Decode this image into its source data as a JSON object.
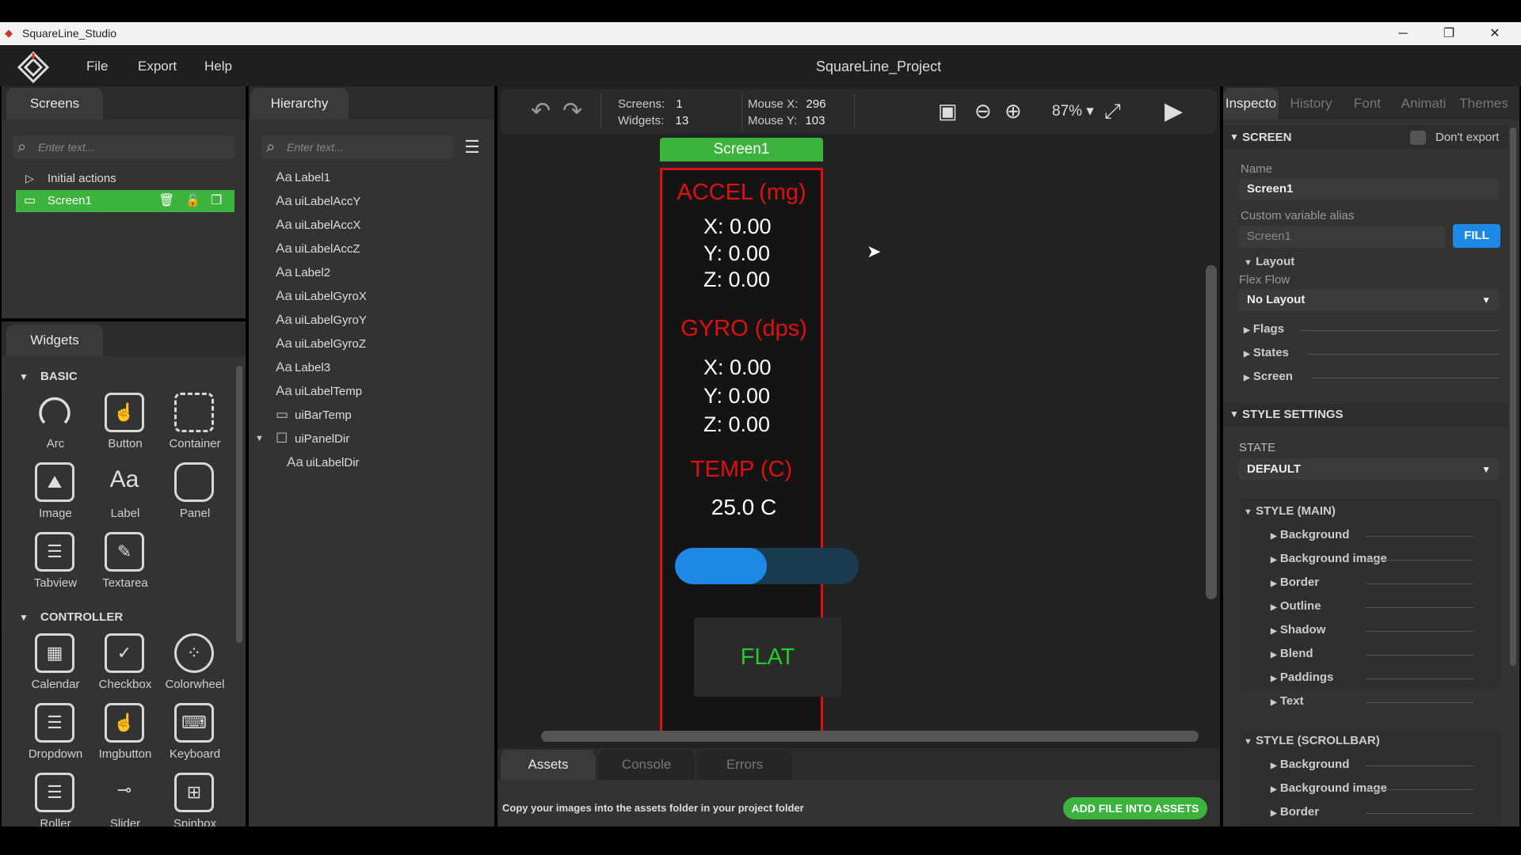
{
  "window": {
    "title": "SquareLine_Studio",
    "min": "─",
    "restore": "❐",
    "close": "✕"
  },
  "menu": {
    "file": "File",
    "export": "Export",
    "help": "Help",
    "project_title": "SquareLine_Project"
  },
  "screens_panel": {
    "tab": "Screens",
    "search_placeholder": "Enter text...",
    "items": [
      {
        "label": "Initial actions"
      },
      {
        "label": "Screen1"
      }
    ]
  },
  "widgets_panel": {
    "tab": "Widgets",
    "basic_header": "BASIC",
    "controller_header": "CONTROLLER",
    "basic": [
      "Arc",
      "Button",
      "Container",
      "Image",
      "Label",
      "Panel",
      "Tabview",
      "Textarea"
    ],
    "controller": [
      "Calendar",
      "Checkbox",
      "Colorwheel",
      "Dropdown",
      "Imgbutton",
      "Keyboard",
      "Roller",
      "Slider",
      "Spinbox"
    ]
  },
  "hierarchy": {
    "tab": "Hierarchy",
    "search_placeholder": "Enter text...",
    "aa": "Aa",
    "items": [
      "Label1",
      "uiLabelAccY",
      "uiLabelAccX",
      "uiLabelAccZ",
      "Label2",
      "uiLabelGyroX",
      "uiLabelGyroY",
      "uiLabelGyroZ",
      "Label3",
      "uiLabelTemp",
      "uiBarTemp",
      "uiPanelDir",
      "uiLabelDir"
    ]
  },
  "toolbar": {
    "screens_label": "Screens:",
    "screens_val": "1",
    "widgets_label": "Widgets:",
    "widgets_val": "13",
    "mousex_label": "Mouse X:",
    "mousex_val": "296",
    "mousey_label": "Mouse Y:",
    "mousey_val": "103",
    "zoom": "87%"
  },
  "canvas": {
    "screen_tab": "Screen1",
    "accel_title": "ACCEL (mg)",
    "ax": "X: 0.00",
    "ay": "Y: 0.00",
    "az": "Z: 0.00",
    "gyro_title": "GYRO (dps)",
    "gx": "X: 0.00",
    "gy": "Y: 0.00",
    "gz": "Z: 0.00",
    "temp_title": "TEMP (C)",
    "temp_val": "25.0 C",
    "bar_fraction": 0.5,
    "dir_label": "FLAT"
  },
  "bottom": {
    "tabs": [
      "Assets",
      "Console",
      "Errors"
    ],
    "hint": "Copy your images into the assets folder in your project folder",
    "add_btn": "ADD FILE INTO ASSETS"
  },
  "inspector": {
    "tabs": [
      "Inspecto",
      "History",
      "Font",
      "Animati",
      "Themes"
    ],
    "screen_header": "SCREEN",
    "dont_export": "Don't export",
    "name_label": "Name",
    "name_val": "Screen1",
    "alias_label": "Custom variable alias",
    "alias_val": "Screen1",
    "fill_btn": "FILL",
    "layout": "Layout",
    "flexflow_label": "Flex Flow",
    "flexflow_val": "No Layout",
    "collapsibles": [
      "Flags",
      "States",
      "Screen"
    ],
    "style_settings": "STYLE SETTINGS",
    "state_label": "STATE",
    "state_val": "DEFAULT",
    "style_main": "STYLE (MAIN)",
    "main_items": [
      "Background",
      "Background image",
      "Border",
      "Outline",
      "Shadow",
      "Blend",
      "Paddings",
      "Text"
    ],
    "style_scrollbar": "STYLE (SCROLLBAR)",
    "scroll_items": [
      "Background",
      "Background image",
      "Border"
    ]
  },
  "colors": {
    "accent_green": "#3cb33c",
    "accent_blue": "#1e88e5",
    "device_red": "#e01010"
  }
}
